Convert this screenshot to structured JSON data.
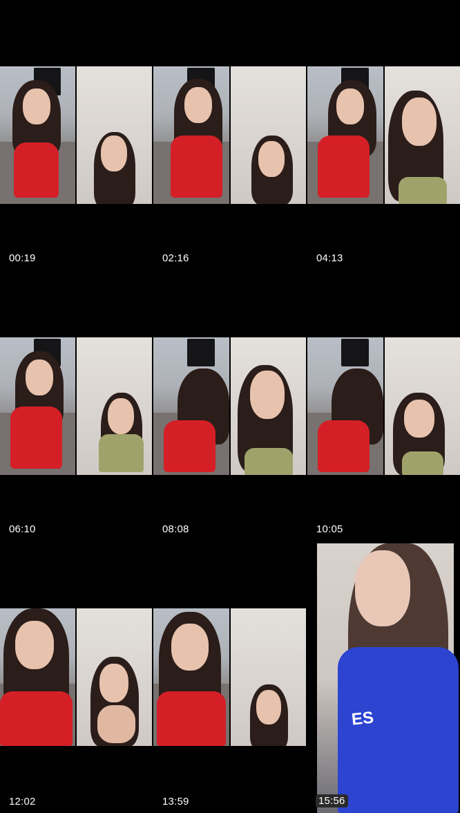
{
  "videos": [
    {
      "timestamp": "00:19"
    },
    {
      "timestamp": "02:16"
    },
    {
      "timestamp": "04:13"
    },
    {
      "timestamp": "06:10"
    },
    {
      "timestamp": "08:08"
    },
    {
      "timestamp": "10:05"
    },
    {
      "timestamp": "12:02"
    },
    {
      "timestamp": "13:59"
    },
    {
      "timestamp": "15:56",
      "selected": true,
      "shirt_text": "ES"
    }
  ],
  "colors": {
    "background": "#000000",
    "timestamp_text": "#ffffff",
    "red_top": "#d51f27",
    "green_top": "#9fa36b",
    "blue_shirt": "#2d44d1"
  }
}
